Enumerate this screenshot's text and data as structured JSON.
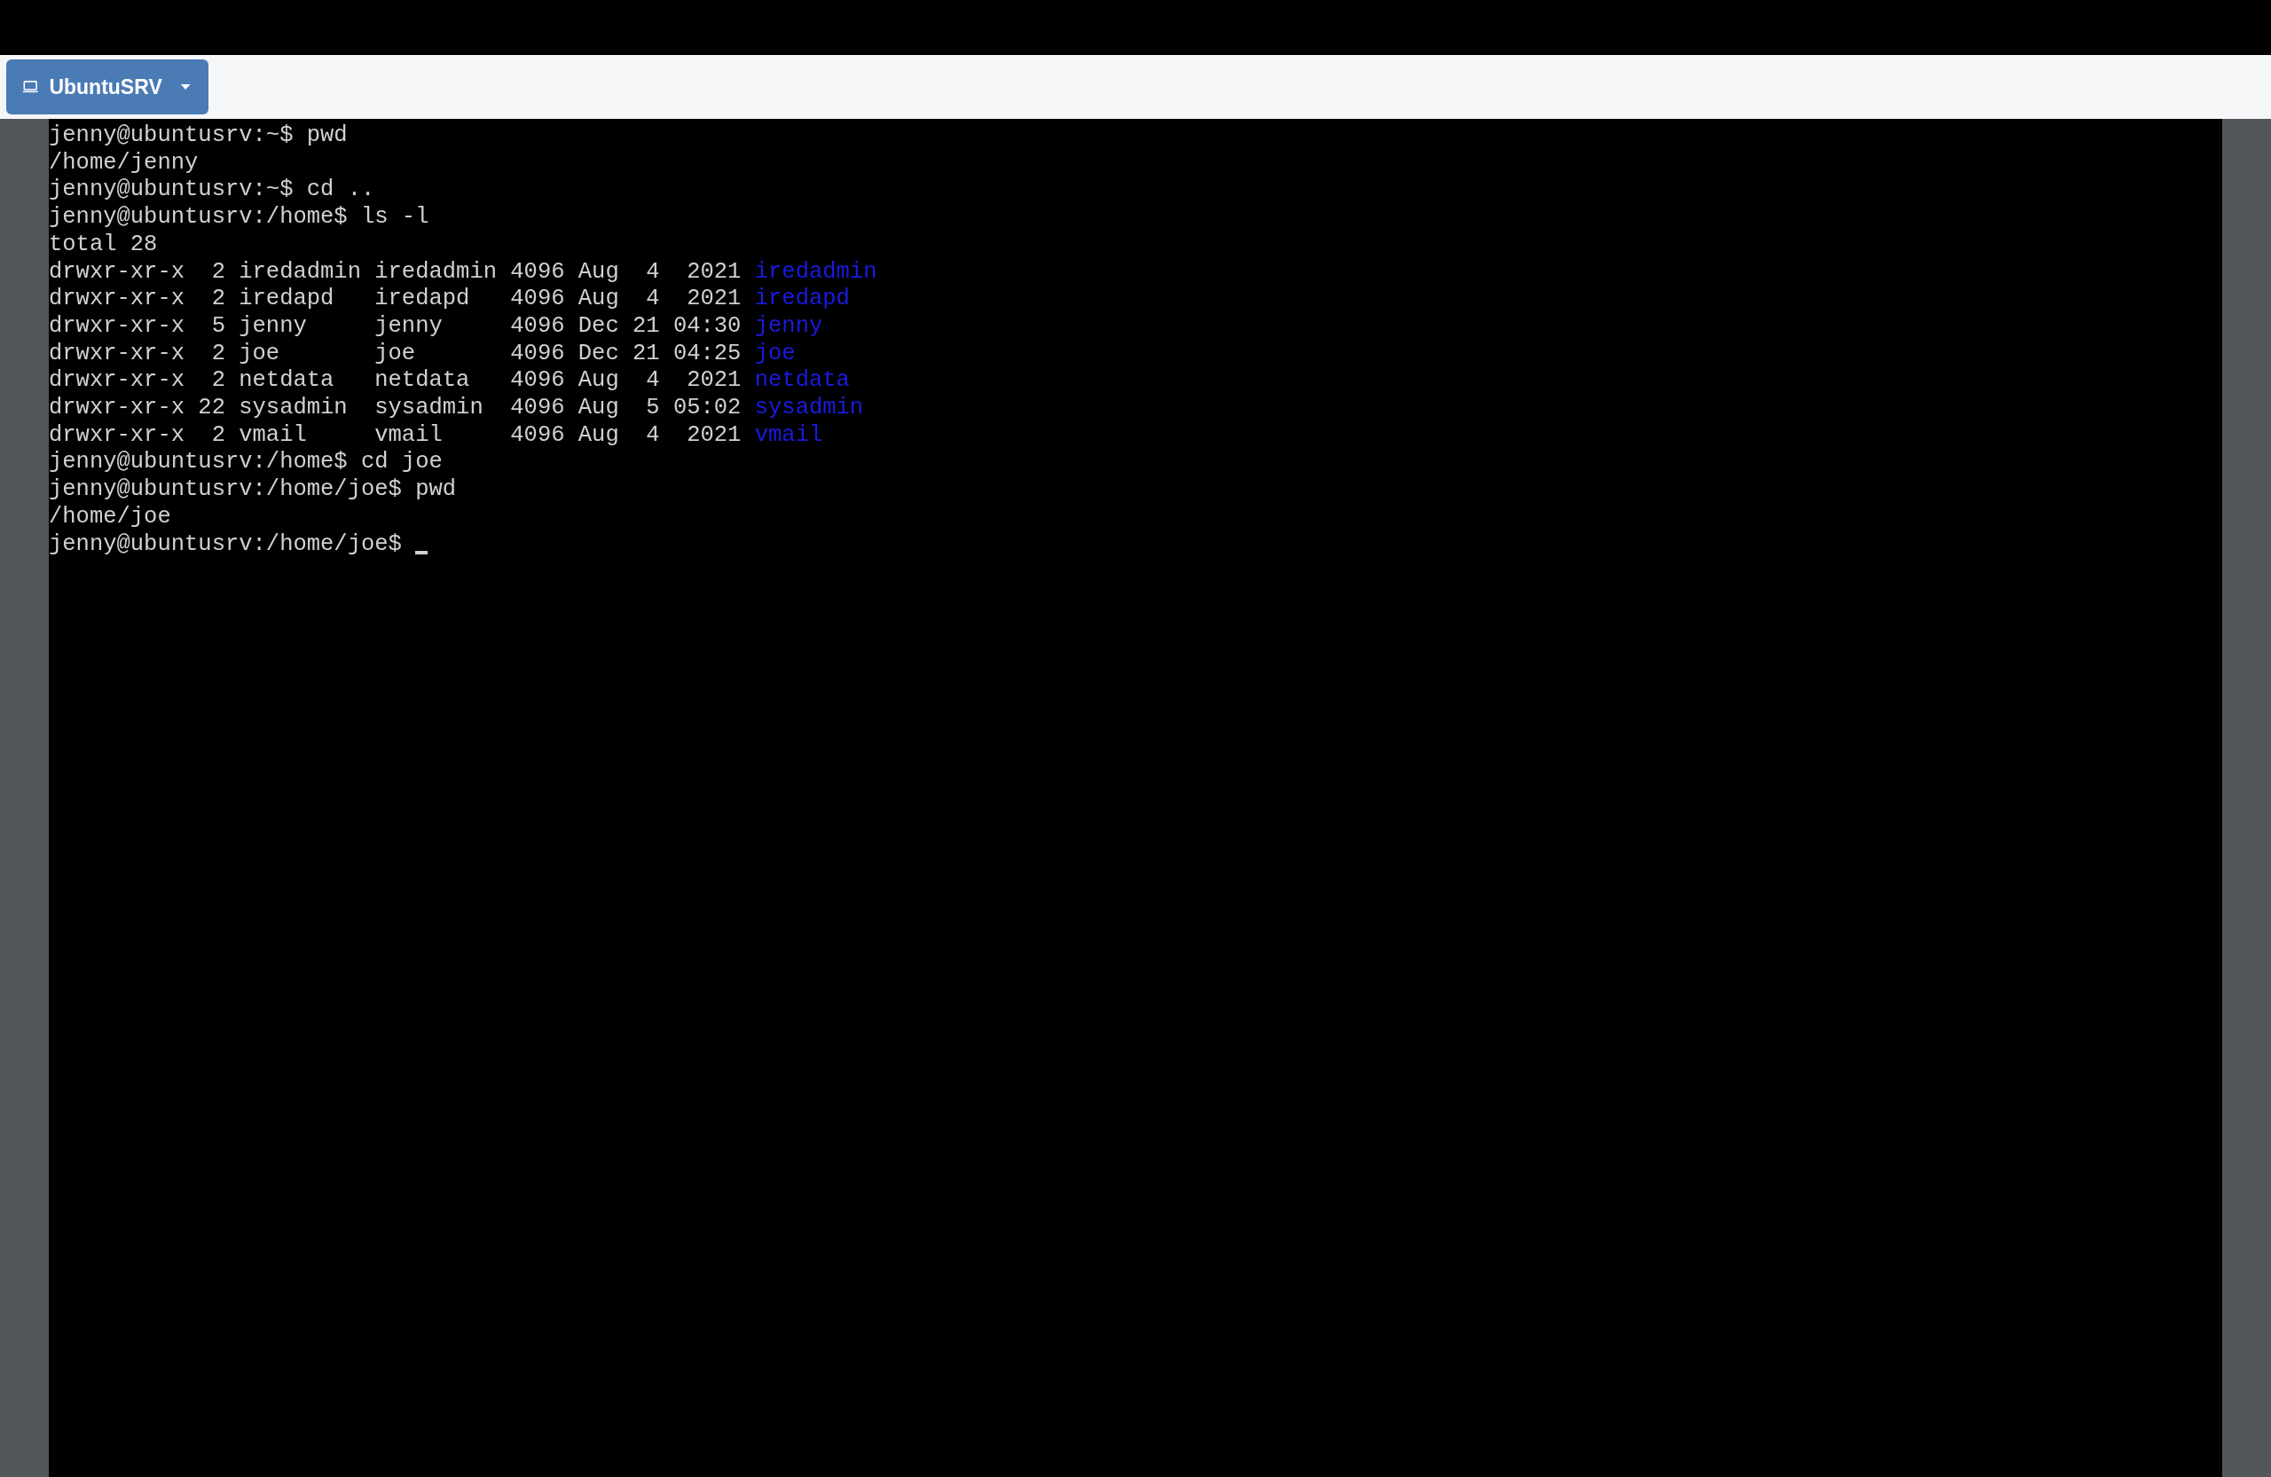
{
  "toolbar": {
    "machine_button": {
      "label": "UbuntuSRV"
    }
  },
  "terminal": {
    "lines": [
      {
        "kind": "plain",
        "text": "jenny@ubuntusrv:~$ pwd"
      },
      {
        "kind": "plain",
        "text": "/home/jenny"
      },
      {
        "kind": "plain",
        "text": "jenny@ubuntusrv:~$ cd .."
      },
      {
        "kind": "plain",
        "text": "jenny@ubuntusrv:/home$ ls -l"
      },
      {
        "kind": "plain",
        "text": "total 28"
      },
      {
        "kind": "listing",
        "text": "drwxr-xr-x  2 iredadmin iredadmin 4096 Aug  4  2021",
        "name": "iredadmin"
      },
      {
        "kind": "listing",
        "text": "drwxr-xr-x  2 iredapd   iredapd   4096 Aug  4  2021",
        "name": "iredapd"
      },
      {
        "kind": "listing",
        "text": "drwxr-xr-x  5 jenny     jenny     4096 Dec 21 04:30",
        "name": "jenny"
      },
      {
        "kind": "listing",
        "text": "drwxr-xr-x  2 joe       joe       4096 Dec 21 04:25",
        "name": "joe"
      },
      {
        "kind": "listing",
        "text": "drwxr-xr-x  2 netdata   netdata   4096 Aug  4  2021",
        "name": "netdata"
      },
      {
        "kind": "listing",
        "text": "drwxr-xr-x 22 sysadmin  sysadmin  4096 Aug  5 05:02",
        "name": "sysadmin"
      },
      {
        "kind": "listing",
        "text": "drwxr-xr-x  2 vmail     vmail     4096 Aug  4  2021",
        "name": "vmail"
      },
      {
        "kind": "plain",
        "text": "jenny@ubuntusrv:/home$ cd joe"
      },
      {
        "kind": "plain",
        "text": "jenny@ubuntusrv:/home/joe$ pwd"
      },
      {
        "kind": "plain",
        "text": "/home/joe"
      },
      {
        "kind": "prompt",
        "text": "jenny@ubuntusrv:/home/joe$",
        "cursor": true
      }
    ]
  }
}
